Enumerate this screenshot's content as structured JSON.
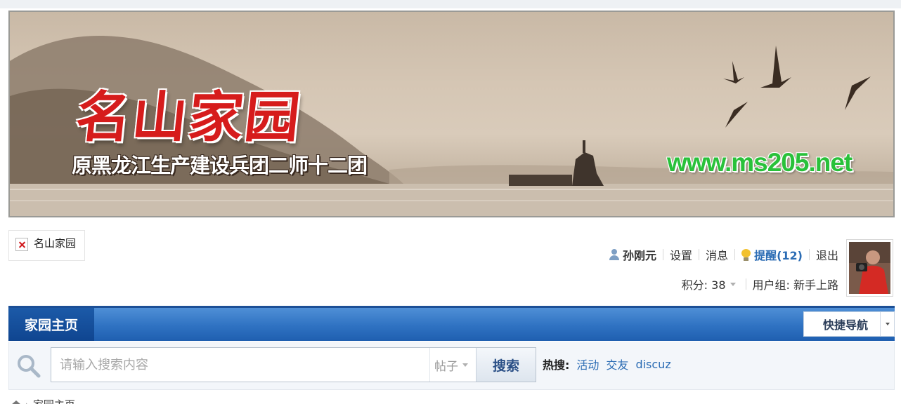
{
  "banner": {
    "logo_text": "名山家园",
    "subtitle": "原黑龙江生产建设兵团二师十二团",
    "url": "www.ms205.net"
  },
  "site_logo": {
    "alt_text": "名山家园",
    "icon": "broken-image-icon"
  },
  "user": {
    "icon": "user-icon",
    "name": "孙刚元",
    "settings_label": "设置",
    "messages_label": "消息",
    "remind_icon": "lightbulb-icon",
    "remind_label": "提醒(12)",
    "logout_label": "退出",
    "points_label": "积分: 38",
    "group_label": "用户组: 新手上路"
  },
  "nav": {
    "home_label": "家园主页",
    "quicknav_label": "快捷导航"
  },
  "search": {
    "placeholder": "请输入搜索内容",
    "type_label": "帖子",
    "button_label": "搜索",
    "hot_label": "热搜:",
    "hot_links": [
      "活动",
      "交友",
      "discuz"
    ]
  },
  "breadcrumb": {
    "current": "家园主页"
  },
  "colors": {
    "nav_blue": "#2f72c2",
    "nav_home": "#0f4590",
    "link_blue": "#2b6cb4",
    "logo_red": "#d61c1c",
    "url_green": "#29c13a"
  }
}
